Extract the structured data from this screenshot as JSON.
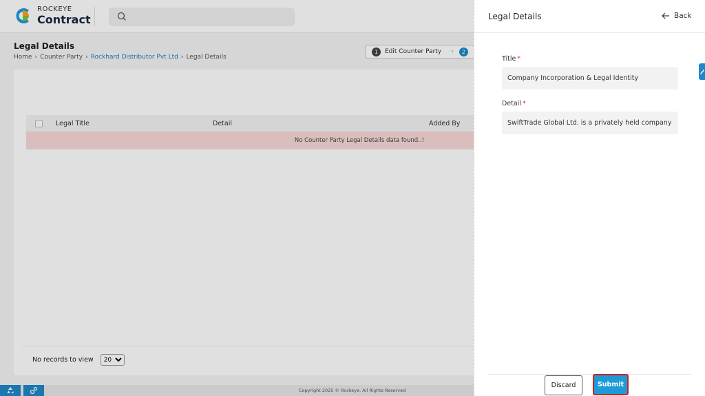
{
  "app": {
    "logo_top": "ROCKEYE",
    "logo_bottom": "Contract"
  },
  "page": {
    "title": "Legal Details",
    "breadcrumb": [
      "Home",
      "Counter Party",
      "Rockhard Distributor Pvt Ltd",
      "Legal Details"
    ],
    "step": {
      "number": "1",
      "label": "Edit Counter Party",
      "next_number": "2"
    }
  },
  "table": {
    "columns": [
      "Legal Title",
      "Detail",
      "Added By"
    ],
    "empty_message": "No Counter Party Legal Details data found..!"
  },
  "pager": {
    "label": "No records to view",
    "page_size": "20"
  },
  "footer": {
    "copyright": "Copyright 2025 © Rockeye. All Rights Reserved"
  },
  "drawer": {
    "title": "Legal Details",
    "back_label": "Back",
    "fields": {
      "title_label": "Title",
      "title_value": "Company Incorporation & Legal Identity",
      "detail_label": "Detail",
      "detail_value": "SwiftTrade Global Ltd. is a privately held company registered"
    },
    "discard_label": "Discard",
    "submit_label": "Submit"
  },
  "colors": {
    "accent": "#1e9bd7",
    "highlight_border": "#d21f1f",
    "empty_row": "#f9d9d9"
  }
}
